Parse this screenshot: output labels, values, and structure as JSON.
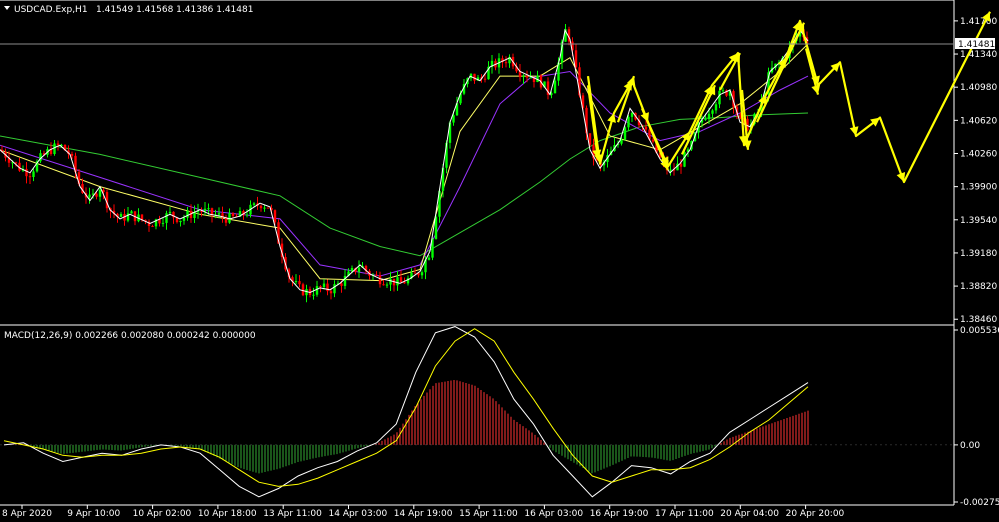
{
  "header": {
    "symbol_title": "USDCAD.Exp,H1",
    "ohlc": "1.41549 1.41568 1.41386 1.41481",
    "macd_title": "MACD(12,26,9) 0.002266 0.002080 0.000242 0.000000"
  },
  "colors": {
    "background": "#000000",
    "bull": "#00ff00",
    "bear": "#ff0000",
    "ma_fast": "#ffffff",
    "ma_mid": "#ffff66",
    "ma_slow": "#9933ff",
    "ma_long": "#33cc33",
    "macd_line": "#ffffff",
    "signal_line": "#ffff00",
    "hist_pos": "#ff3333",
    "hist_neg": "#33aa33",
    "forecast": "#ffff00",
    "grid": "#808080"
  },
  "chart_data": [
    {
      "type": "candlestick",
      "title": "USDCAD.Exp,H1",
      "y_ticks": [
        "1.41700",
        "1.41340",
        "1.40980",
        "1.40620",
        "1.40260",
        "1.39900",
        "1.39540",
        "1.39180",
        "1.38820",
        "1.38460"
      ],
      "current_price": "1.41481",
      "ylim": [
        1.3843,
        1.4184
      ],
      "x_ticks": [
        "8 Apr 2020",
        "9 Apr 10:00",
        "10 Apr 02:00",
        "10 Apr 18:00",
        "13 Apr 11:00",
        "14 Apr 03:00",
        "14 Apr 19:00",
        "15 Apr 11:00",
        "16 Apr 03:00",
        "16 Apr 19:00",
        "17 Apr 11:00",
        "20 Apr 04:00",
        "20 Apr 20:00"
      ],
      "close_path": [
        [
          0,
          1.403
        ],
        [
          10,
          1.402
        ],
        [
          20,
          1.401
        ],
        [
          30,
          1.4005
        ],
        [
          40,
          1.402
        ],
        [
          50,
          1.403
        ],
        [
          60,
          1.4035
        ],
        [
          70,
          1.4025
        ],
        [
          80,
          1.399
        ],
        [
          90,
          1.3975
        ],
        [
          100,
          1.399
        ],
        [
          110,
          1.3965
        ],
        [
          120,
          1.3955
        ],
        [
          130,
          1.396
        ],
        [
          140,
          1.3955
        ],
        [
          150,
          1.395
        ],
        [
          160,
          1.3955
        ],
        [
          170,
          1.396
        ],
        [
          180,
          1.3955
        ],
        [
          190,
          1.396
        ],
        [
          200,
          1.3965
        ],
        [
          210,
          1.396
        ],
        [
          220,
          1.3958
        ],
        [
          230,
          1.3955
        ],
        [
          240,
          1.3958
        ],
        [
          250,
          1.3965
        ],
        [
          260,
          1.3972
        ],
        [
          270,
          1.3968
        ],
        [
          280,
          1.3925
        ],
        [
          290,
          1.389
        ],
        [
          300,
          1.3878
        ],
        [
          310,
          1.3875
        ],
        [
          320,
          1.388
        ],
        [
          330,
          1.3878
        ],
        [
          340,
          1.3885
        ],
        [
          350,
          1.3895
        ],
        [
          360,
          1.3905
        ],
        [
          370,
          1.3895
        ],
        [
          380,
          1.389
        ],
        [
          390,
          1.3888
        ],
        [
          400,
          1.3885
        ],
        [
          410,
          1.389
        ],
        [
          420,
          1.3898
        ],
        [
          430,
          1.392
        ],
        [
          440,
          1.399
        ],
        [
          450,
          1.406
        ],
        [
          460,
          1.409
        ],
        [
          470,
          1.411
        ],
        [
          480,
          1.4105
        ],
        [
          490,
          1.412
        ],
        [
          500,
          1.4125
        ],
        [
          510,
          1.413
        ],
        [
          520,
          1.4115
        ],
        [
          530,
          1.411
        ],
        [
          540,
          1.4105
        ],
        [
          550,
          1.409
        ],
        [
          560,
          1.413
        ],
        [
          565,
          1.416
        ],
        [
          570,
          1.415
        ],
        [
          580,
          1.409
        ],
        [
          590,
          1.403
        ],
        [
          600,
          1.401
        ],
        [
          610,
          1.4025
        ],
        [
          620,
          1.404
        ],
        [
          630,
          1.4075
        ],
        [
          640,
          1.406
        ],
        [
          650,
          1.404
        ],
        [
          660,
          1.402
        ],
        [
          670,
          1.4005
        ],
        [
          680,
          1.4015
        ],
        [
          690,
          1.403
        ],
        [
          700,
          1.406
        ],
        [
          710,
          1.4075
        ],
        [
          720,
          1.409
        ],
        [
          730,
          1.4095
        ],
        [
          740,
          1.406
        ],
        [
          750,
          1.4055
        ],
        [
          760,
          1.4075
        ],
        [
          770,
          1.4115
        ],
        [
          780,
          1.4125
        ],
        [
          790,
          1.414
        ],
        [
          800,
          1.416
        ],
        [
          808,
          1.4148
        ]
      ],
      "moving_averages": [
        {
          "name": "ma_long",
          "points": [
            [
              0,
              1.4045
            ],
            [
              100,
              1.4025
            ],
            [
              200,
              1.4
            ],
            [
              280,
              1.398
            ],
            [
              330,
              1.3945
            ],
            [
              380,
              1.3925
            ],
            [
              420,
              1.3915
            ],
            [
              460,
              1.394
            ],
            [
              500,
              1.3965
            ],
            [
              540,
              1.3995
            ],
            [
              570,
              1.402
            ],
            [
              600,
              1.404
            ],
            [
              640,
              1.4055
            ],
            [
              680,
              1.4063
            ],
            [
              720,
              1.4065
            ],
            [
              760,
              1.4068
            ],
            [
              808,
              1.407
            ]
          ]
        },
        {
          "name": "ma_slow",
          "points": [
            [
              0,
              1.4035
            ],
            [
              100,
              1.4
            ],
            [
              200,
              1.3965
            ],
            [
              280,
              1.3955
            ],
            [
              320,
              1.3905
            ],
            [
              380,
              1.3893
            ],
            [
              420,
              1.3905
            ],
            [
              460,
              1.399
            ],
            [
              500,
              1.408
            ],
            [
              530,
              1.4108
            ],
            [
              570,
              1.4115
            ],
            [
              610,
              1.407
            ],
            [
              660,
              1.404
            ],
            [
              700,
              1.405
            ],
            [
              740,
              1.407
            ],
            [
              780,
              1.4095
            ],
            [
              808,
              1.411
            ]
          ]
        },
        {
          "name": "ma_mid",
          "points": [
            [
              0,
              1.403
            ],
            [
              100,
              1.399
            ],
            [
              200,
              1.396
            ],
            [
              280,
              1.3945
            ],
            [
              320,
              1.389
            ],
            [
              380,
              1.3888
            ],
            [
              420,
              1.39
            ],
            [
              460,
              1.405
            ],
            [
              500,
              1.411
            ],
            [
              540,
              1.411
            ],
            [
              570,
              1.413
            ],
            [
              610,
              1.4045
            ],
            [
              660,
              1.403
            ],
            [
              700,
              1.4055
            ],
            [
              740,
              1.408
            ],
            [
              780,
              1.4115
            ],
            [
              808,
              1.4145
            ]
          ]
        }
      ]
    },
    {
      "type": "line",
      "title": "MACD(12,26,9)",
      "series": [
        {
          "name": "macd_main",
          "values": [
            0.0,
            0.0001,
            -0.0004,
            -0.0008,
            -0.0006,
            -0.0004,
            -0.0005,
            -0.0002,
            0.0,
            -0.0001,
            -0.0004,
            -0.0012,
            -0.002,
            -0.0025,
            -0.0021,
            -0.0015,
            -0.0011,
            -0.0008,
            -0.0003,
            0.0001,
            0.001,
            0.0035,
            0.0054,
            0.0057,
            0.0052,
            0.004,
            0.0022,
            0.001,
            -0.0005,
            -0.0015,
            -0.0025,
            -0.0018,
            -0.001,
            -0.0011,
            -0.0014,
            -0.0008,
            -0.0004,
            0.0006,
            0.0012,
            0.0018,
            0.0024,
            0.003
          ]
        },
        {
          "name": "signal",
          "values": [
            0.0002,
            0.0,
            -0.0002,
            -0.0005,
            -0.0006,
            -0.0005,
            -0.0005,
            -0.0004,
            -0.0002,
            -0.0001,
            -0.0002,
            -0.0006,
            -0.0012,
            -0.0018,
            -0.002,
            -0.0019,
            -0.0016,
            -0.0012,
            -0.0008,
            -0.0004,
            0.0002,
            0.0018,
            0.0038,
            0.005,
            0.0056,
            0.005,
            0.0035,
            0.0022,
            0.0008,
            -0.0005,
            -0.0015,
            -0.0018,
            -0.0015,
            -0.0012,
            -0.0012,
            -0.0011,
            -0.0007,
            -0.0001,
            0.0006,
            0.0012,
            0.002,
            0.0028
          ]
        }
      ],
      "y_ticks": [
        "0.005536",
        "0.00",
        "-0.002752"
      ],
      "ylim": [
        -0.002752,
        0.005536
      ]
    }
  ],
  "forecast_zigzag": [
    [
      [
        588,
        1.411
      ],
      [
        600,
        1.4015
      ],
      [
        614,
        1.407
      ],
      [
        632,
        1.4105
      ],
      [
        648,
        1.406
      ],
      [
        668,
        1.4012
      ],
      [
        690,
        1.405
      ],
      [
        712,
        1.41
      ],
      [
        738,
        1.4135
      ],
      [
        744,
        1.4035
      ],
      [
        766,
        1.409
      ],
      [
        786,
        1.413
      ],
      [
        800,
        1.417
      ],
      [
        818,
        1.41
      ],
      [
        840,
        1.4125
      ],
      [
        856,
        1.4045
      ],
      [
        880,
        1.4065
      ],
      [
        904,
        1.3995
      ],
      [
        990,
        1.418
      ]
    ],
    [
      [
        588,
        1.41
      ],
      [
        598,
        1.402
      ]
    ],
    [
      [
        618,
        1.406
      ],
      [
        634,
        1.411
      ]
    ],
    [
      [
        642,
        1.4075
      ],
      [
        668,
        1.4008
      ]
    ],
    [
      [
        682,
        1.4025
      ],
      [
        715,
        1.41
      ]
    ],
    [
      [
        720,
        1.4095
      ],
      [
        740,
        1.4135
      ]
    ],
    [
      [
        742,
        1.4095
      ],
      [
        748,
        1.403
      ]
    ],
    [
      [
        757,
        1.406
      ],
      [
        804,
        1.4168
      ]
    ],
    [
      [
        806,
        1.414
      ],
      [
        818,
        1.409
      ]
    ]
  ]
}
